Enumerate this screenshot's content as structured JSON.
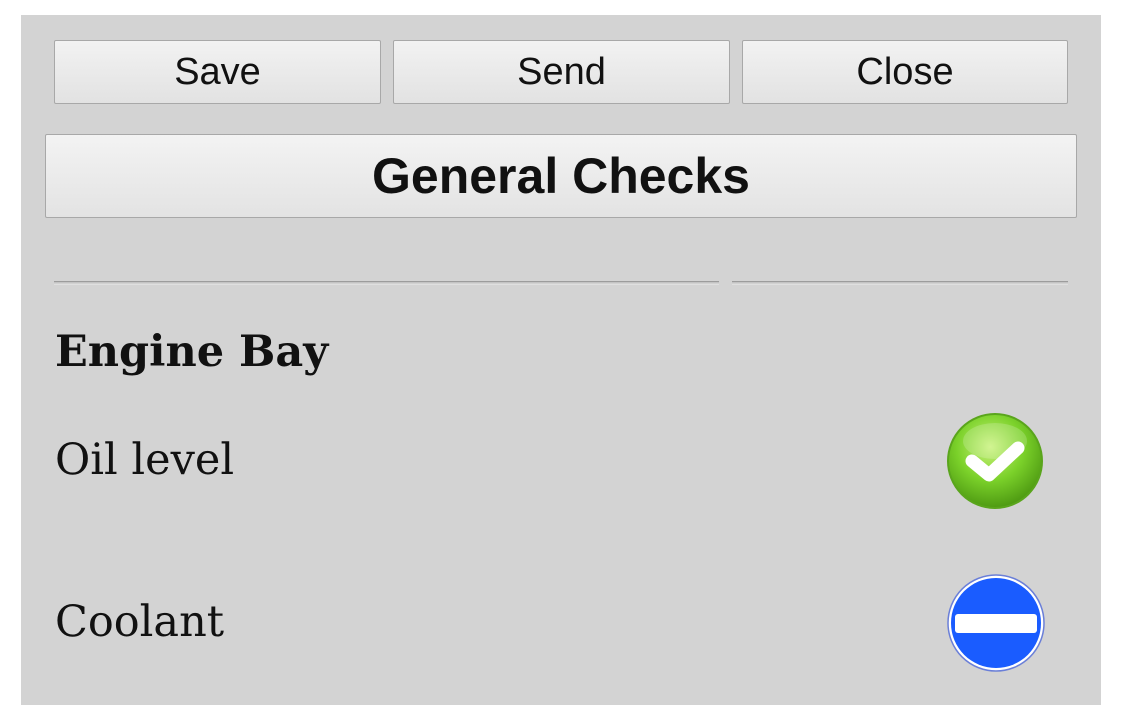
{
  "toolbar": {
    "save_label": "Save",
    "send_label": "Send",
    "close_label": "Close"
  },
  "header": {
    "title": "General Checks"
  },
  "section": {
    "title": "Engine Bay",
    "items": [
      {
        "label": "Oil level",
        "status": "ok",
        "status_icon": "check-icon",
        "status_color": "#7bd12a"
      },
      {
        "label": "Coolant",
        "status": "not-applicable",
        "status_icon": "no-entry-icon",
        "status_color": "#1a5cff"
      }
    ]
  }
}
